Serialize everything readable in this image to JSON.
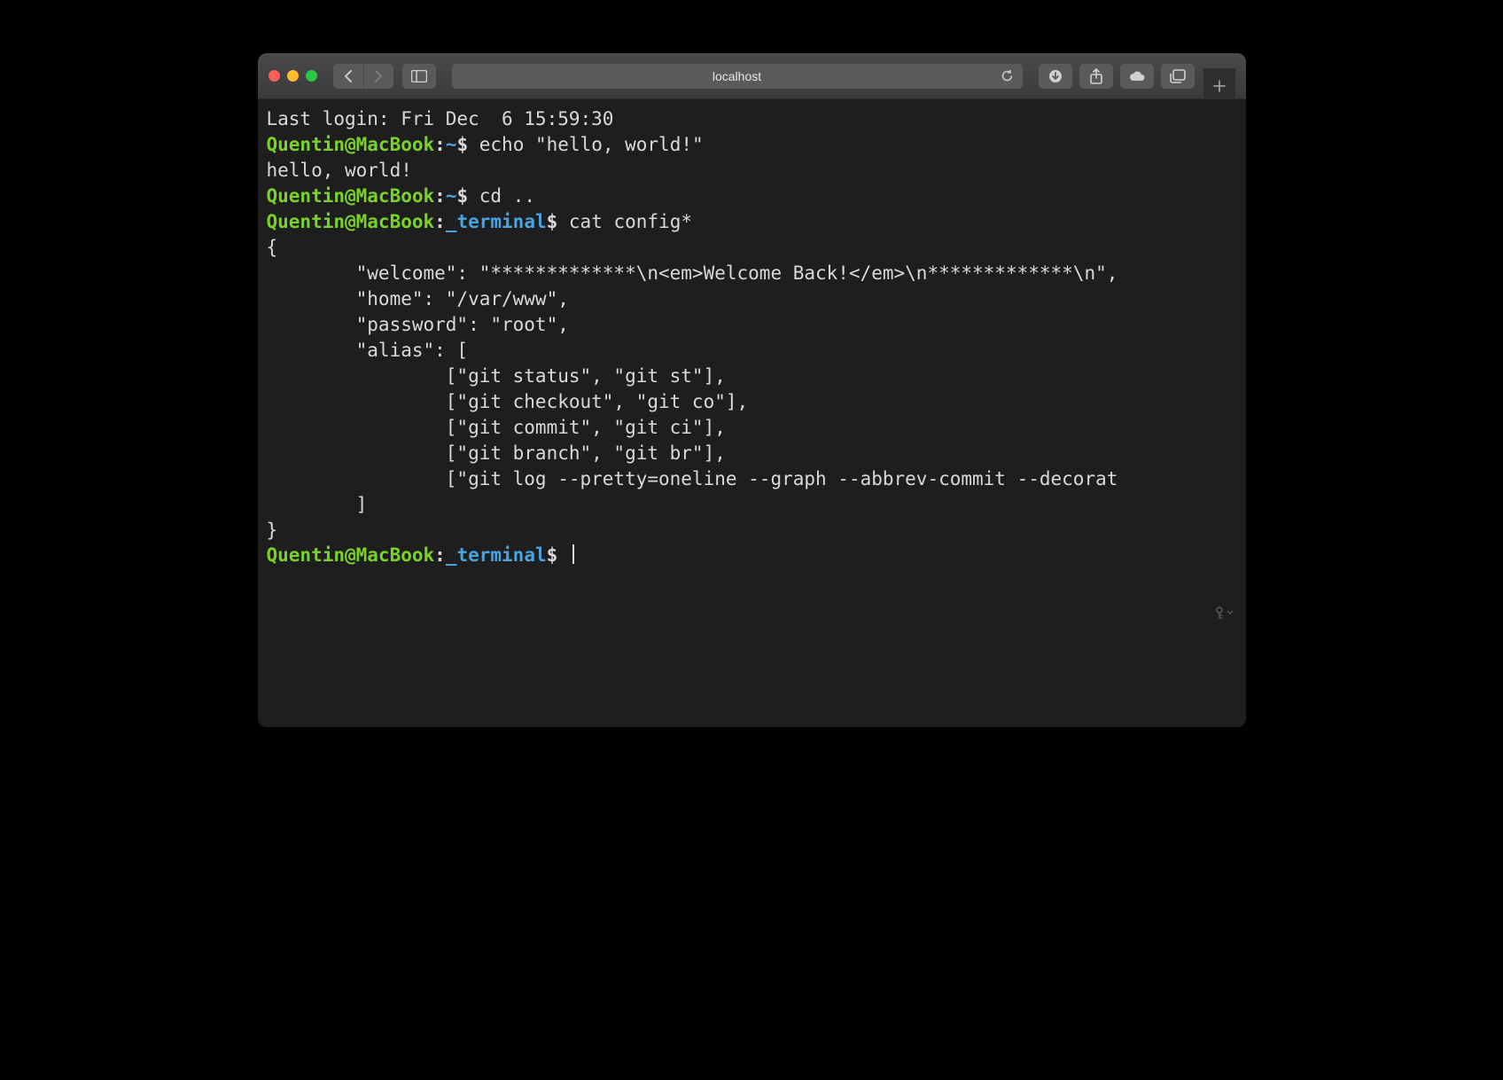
{
  "titlebar": {
    "address": "localhost"
  },
  "terminal": {
    "last_login": "Last login: Fri Dec  6 15:59:30",
    "lines": [
      {
        "user": "Quentin@MacBook",
        "path": "~",
        "cmd": "echo \"hello, world!\""
      },
      {
        "out": "hello, world!"
      },
      {
        "user": "Quentin@MacBook",
        "path": "~",
        "cmd": "cd .."
      },
      {
        "user": "Quentin@MacBook",
        "path": "_terminal",
        "cmd": "cat config*"
      }
    ],
    "cat_output": "{\n        \"welcome\": \"*************\\n<em>Welcome Back!</em>\\n*************\\n\",\n        \"home\": \"/var/www\",\n        \"password\": \"root\",\n        \"alias\": [\n                [\"git status\", \"git st\"],\n                [\"git checkout\", \"git co\"],\n                [\"git commit\", \"git ci\"],\n                [\"git branch\", \"git br\"],\n                [\"git log --pretty=oneline --graph --abbrev-commit --decorat\n        ]\n}",
    "current_prompt": {
      "user": "Quentin@MacBook",
      "path": "_terminal"
    }
  }
}
